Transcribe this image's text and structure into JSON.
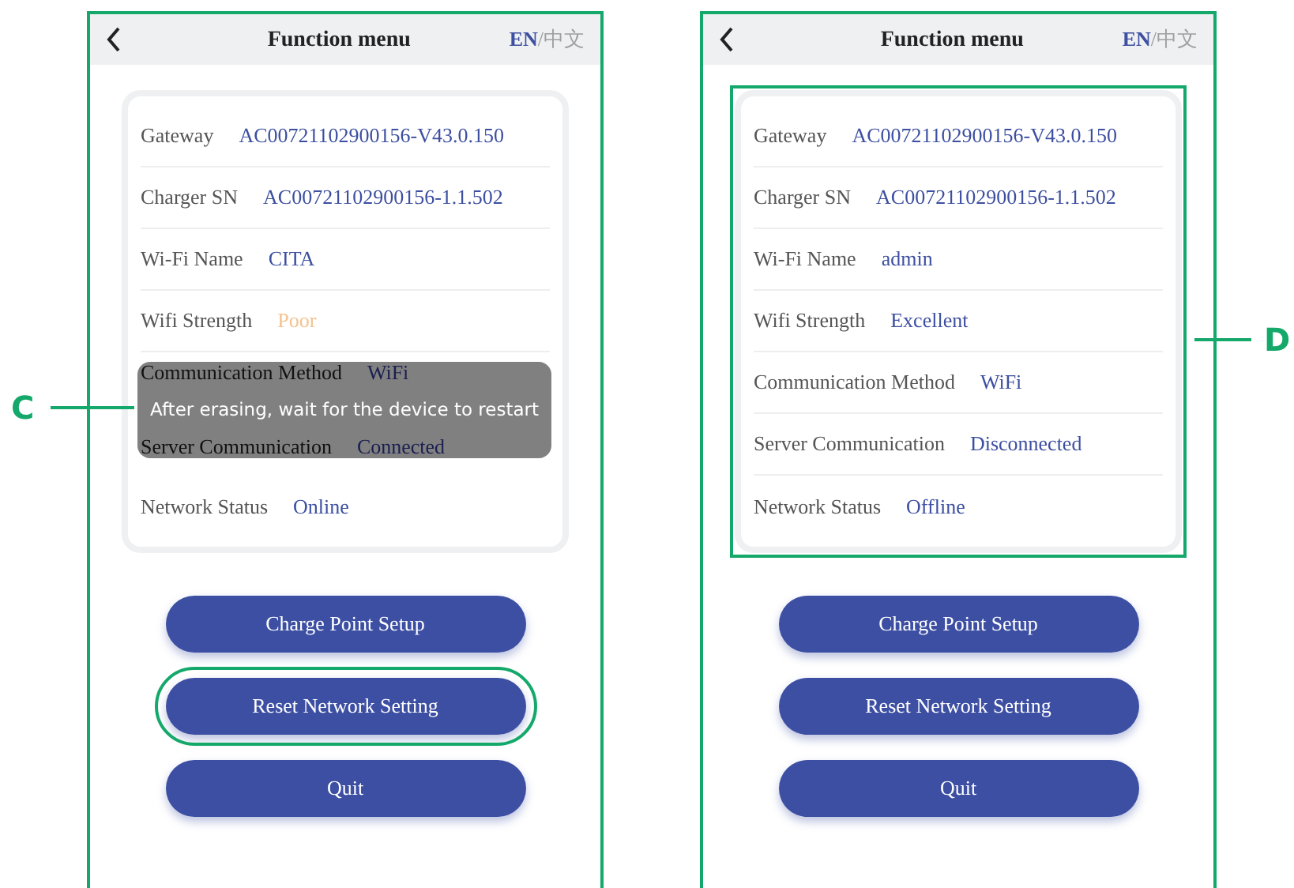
{
  "screens": [
    {
      "annotation": {
        "label": "C",
        "kind": "left"
      },
      "title": "Function menu",
      "languages": [
        {
          "label": "EN",
          "selected": true
        },
        {
          "label": "中文",
          "selected": false
        }
      ],
      "language_separator": "/",
      "card_highlighted": false,
      "rows": [
        {
          "label": "Gateway",
          "value": "AC00721102900156-V43.0.150",
          "color": "#3d4fa1",
          "covered": false
        },
        {
          "label": "Charger SN",
          "value": "AC00721102900156-1.1.502",
          "color": "#3d4fa1",
          "covered": false
        },
        {
          "label": "Wi-Fi Name",
          "value": "CITA",
          "color": "#3d4fa1",
          "covered": false
        },
        {
          "label": "Wifi Strength",
          "value": "Poor",
          "color": "#f5c28e",
          "covered": false
        },
        {
          "label": "Communication Method",
          "value": "WiFi",
          "color": "#1a1f50",
          "covered": true
        },
        {
          "label": "Server Communication",
          "value": "Connected",
          "color": "#1a1f50",
          "covered": true
        },
        {
          "label": "Network Status",
          "value": "Online",
          "color": "#3d4fa1",
          "covered": false
        }
      ],
      "toast": "After erasing, wait for the device to restart",
      "buttons": [
        {
          "label": "Charge Point Setup",
          "highlighted": false
        },
        {
          "label": "Reset Network Setting",
          "highlighted": true
        },
        {
          "label": "Quit",
          "highlighted": false
        }
      ]
    },
    {
      "annotation": {
        "label": "D",
        "kind": "right"
      },
      "title": "Function menu",
      "languages": [
        {
          "label": "EN",
          "selected": true
        },
        {
          "label": "中文",
          "selected": false
        }
      ],
      "language_separator": "/",
      "card_highlighted": true,
      "rows": [
        {
          "label": "Gateway",
          "value": "AC00721102900156-V43.0.150",
          "color": "#3d4fa1",
          "covered": false
        },
        {
          "label": "Charger SN",
          "value": "AC00721102900156-1.1.502",
          "color": "#3d4fa1",
          "covered": false
        },
        {
          "label": "Wi-Fi Name",
          "value": "admin",
          "color": "#3d4fa1",
          "covered": false
        },
        {
          "label": "Wifi Strength",
          "value": "Excellent",
          "color": "#3d4fa1",
          "covered": false
        },
        {
          "label": "Communication Method",
          "value": "WiFi",
          "color": "#3d4fa1",
          "covered": false
        },
        {
          "label": "Server Communication",
          "value": "Disconnected",
          "color": "#3d4fa1",
          "covered": false
        },
        {
          "label": "Network Status",
          "value": "Offline",
          "color": "#3d4fa1",
          "covered": false
        }
      ],
      "buttons": [
        {
          "label": "Charge Point Setup",
          "highlighted": false
        },
        {
          "label": "Reset Network Setting",
          "highlighted": false
        },
        {
          "label": "Quit",
          "highlighted": false
        }
      ]
    }
  ]
}
